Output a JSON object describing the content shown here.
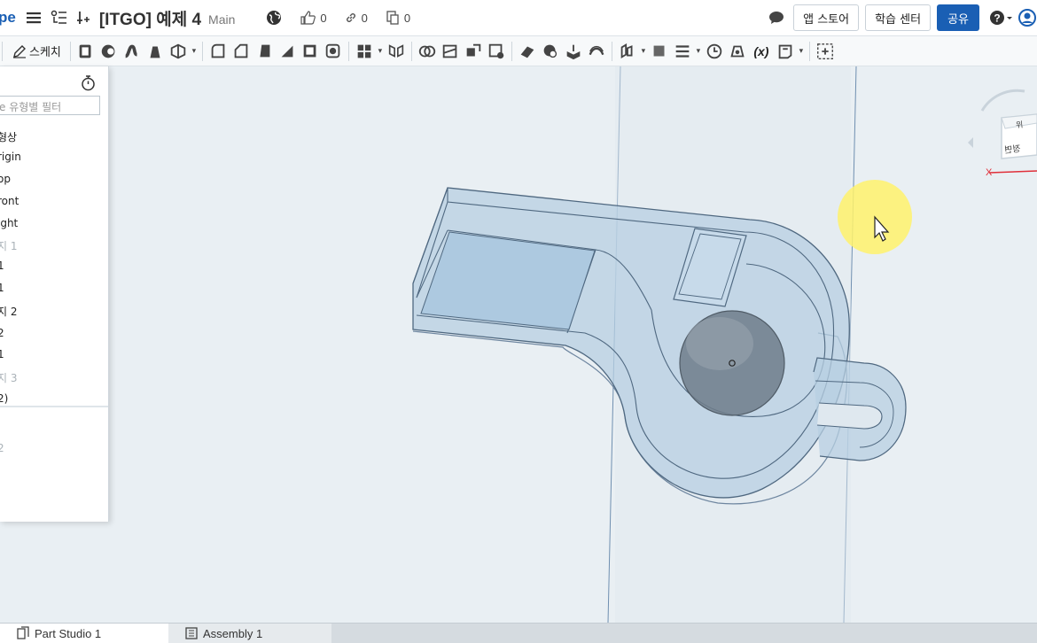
{
  "header": {
    "logo_fragment": "pe",
    "doc_title": "[ITGO] 예제 4",
    "workspace": "Main",
    "likes": "0",
    "links": "0",
    "copies": "0",
    "app_store_label": "앱 스토어",
    "learning_center_label": "학습 센터",
    "share_label": "공유"
  },
  "toolbar": {
    "sketch_label": "스케치",
    "variable_label": "(x)"
  },
  "panel": {
    "filter_placeholder": "e 유형별 필터",
    "items": [
      "형상",
      "rigin",
      "op",
      "ront",
      "ight",
      "지 1",
      "1",
      "1",
      "지 2",
      "2",
      "1",
      "지 3",
      "2)",
      "",
      "2"
    ]
  },
  "viewcube": {
    "top_label": "위",
    "front_label": "정면",
    "x_axis": "X"
  },
  "tabs": [
    {
      "label": "Part Studio 1",
      "active": true
    },
    {
      "label": "Assembly 1",
      "active": false
    }
  ],
  "colors": {
    "brand": "#1a5fb4",
    "part_fill": "#b7cfe2",
    "cursor_highlight": "#fff26b"
  }
}
